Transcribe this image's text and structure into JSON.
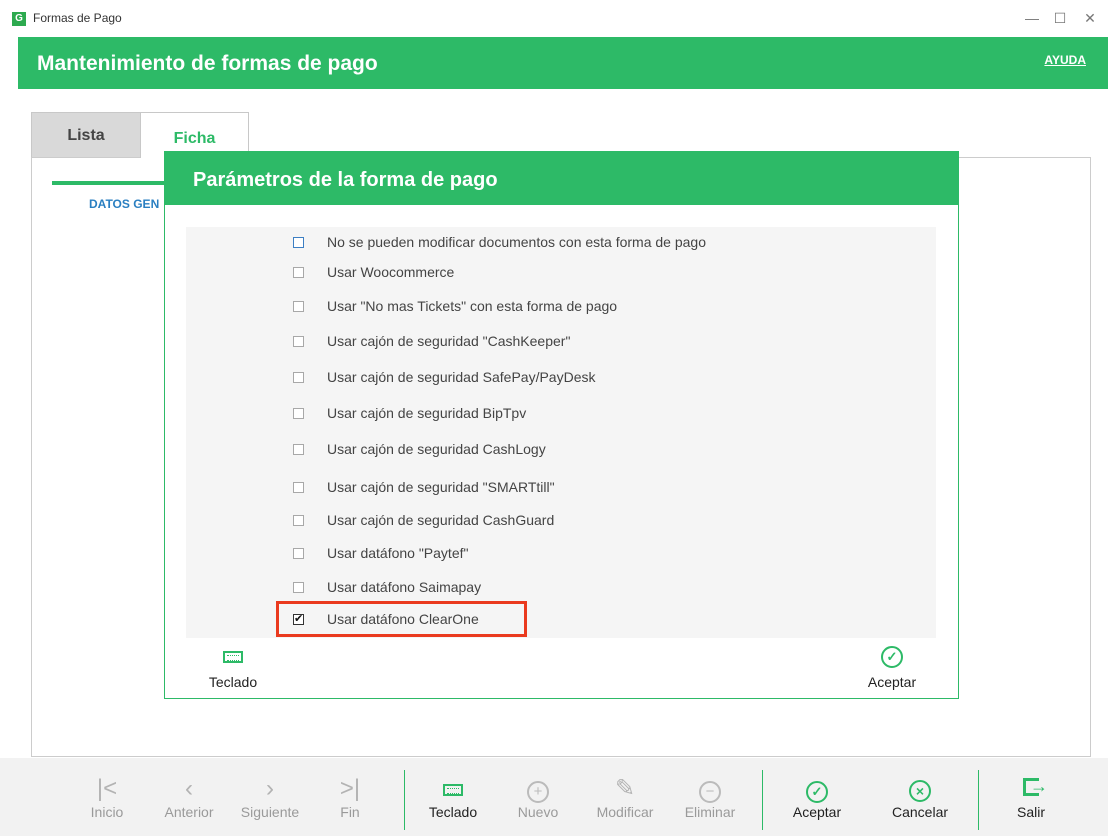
{
  "window": {
    "logo_letter": "G",
    "title": "Formas de Pago",
    "minimize_glyph": "—",
    "maximize_glyph": "☐",
    "close_glyph": "✕"
  },
  "header": {
    "title": "Mantenimiento de formas de pago",
    "help": "AYUDA"
  },
  "tabs": {
    "lista": "Lista",
    "ficha": "Ficha"
  },
  "section_tab": "DATOS GEN",
  "dialog": {
    "title": "Parámetros de la forma de pago",
    "options": [
      {
        "label": "No se pueden modificar documentos con esta forma de pago",
        "checked": false
      },
      {
        "label": "Usar Woocommerce",
        "checked": false
      },
      {
        "label": "Usar \"No mas Tickets\" con esta forma de pago",
        "checked": false
      },
      {
        "label": "Usar cajón de seguridad \"CashKeeper\"",
        "checked": false
      },
      {
        "label": "Usar cajón de seguridad  SafePay/PayDesk",
        "checked": false
      },
      {
        "label": "Usar cajón de seguridad BipTpv",
        "checked": false
      },
      {
        "label": "Usar cajón de seguridad CashLogy",
        "checked": false
      },
      {
        "label": "Usar cajón de seguridad \"SMARTtill\"",
        "checked": false
      },
      {
        "label": "Usar cajón de seguridad CashGuard",
        "checked": false
      },
      {
        "label": "Usar datáfono \"Paytef\"",
        "checked": false
      },
      {
        "label": "Usar datáfono Saimapay",
        "checked": false
      },
      {
        "label": "Usar datáfono ClearOne",
        "checked": true
      }
    ],
    "keyboard_label": "Teclado",
    "accept_label": "Aceptar"
  },
  "toolbar": {
    "inicio": "Inicio",
    "anterior": "Anterior",
    "siguiente": "Siguiente",
    "fin": "Fin",
    "teclado": "Teclado",
    "nuevo": "Nuevo",
    "modificar": "Modificar",
    "eliminar": "Eliminar",
    "aceptar": "Aceptar",
    "cancelar": "Cancelar",
    "salir": "Salir"
  },
  "colors": {
    "brand_green": "#2dba67",
    "highlight_red": "#ea3a1e"
  }
}
